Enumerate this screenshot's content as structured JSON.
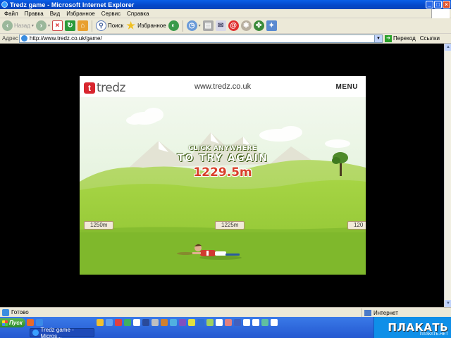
{
  "window": {
    "title": "Tredz game - Microsoft Internet Explorer",
    "buttons": [
      "_",
      "□",
      "×"
    ]
  },
  "menubar": {
    "items": [
      "Файл",
      "Правка",
      "Вид",
      "Избранное",
      "Сервис",
      "Справка"
    ]
  },
  "toolbar": {
    "back_label": "Назад",
    "search_label": "Поиск",
    "favorites_label": "Избранное"
  },
  "address": {
    "label": "Адрес",
    "url": "http://www.tredz.co.uk/game/",
    "go_label": "Переход",
    "links_label": "Ссылки"
  },
  "game": {
    "logo_text": "tredz",
    "logo_mark": "t",
    "site_text": "www.tredz.co.uk",
    "menu_label": "MENU",
    "line1": "CLICK ANYWHERE",
    "line2": "TO TRY AGAIN",
    "distance": "1229.5m",
    "markers": [
      "1250m",
      "1225m",
      "120"
    ]
  },
  "status": {
    "text": "Готово",
    "zone": "Интернет"
  },
  "taskbar": {
    "start_label": "Пуск",
    "task_label": "Tredz game - Micros...",
    "watermark": "ПЛАКАТЬ",
    "watermark_sub": "ПЛАКАТЬ.НЕТ"
  },
  "colors": {
    "sky": "#e9f5e6",
    "hills": "#9ed04a",
    "distance_text": "#d8402a",
    "titlebar": "#0a5fe8"
  }
}
